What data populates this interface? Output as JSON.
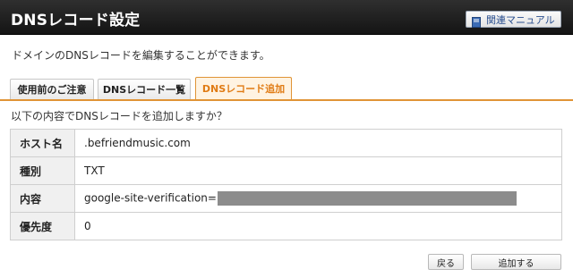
{
  "header": {
    "title": "DNSレコード設定",
    "manual_label": "関連マニュアル"
  },
  "description": "ドメインのDNSレコードを編集することができます。",
  "tabs": [
    {
      "label": "使用前のご注意",
      "active": false
    },
    {
      "label": "DNSレコード一覧",
      "active": false
    },
    {
      "label": "DNSレコード追加",
      "active": true
    }
  ],
  "confirm_text": "以下の内容でDNSレコードを追加しますか？",
  "record": {
    "host_label": "ホスト名",
    "host_value": ".befriendmusic.com",
    "type_label": "種別",
    "type_value": "TXT",
    "content_label": "内容",
    "content_value": "google-site-verification=",
    "priority_label": "優先度",
    "priority_value": "0"
  },
  "buttons": {
    "back_label": "戻る",
    "add_label": "追加する"
  },
  "colors": {
    "accent": "#e07b14",
    "header_bg": "#1e1e1e",
    "link_blue": "#2a4f8f"
  },
  "icons": {
    "manual": "book-icon"
  }
}
